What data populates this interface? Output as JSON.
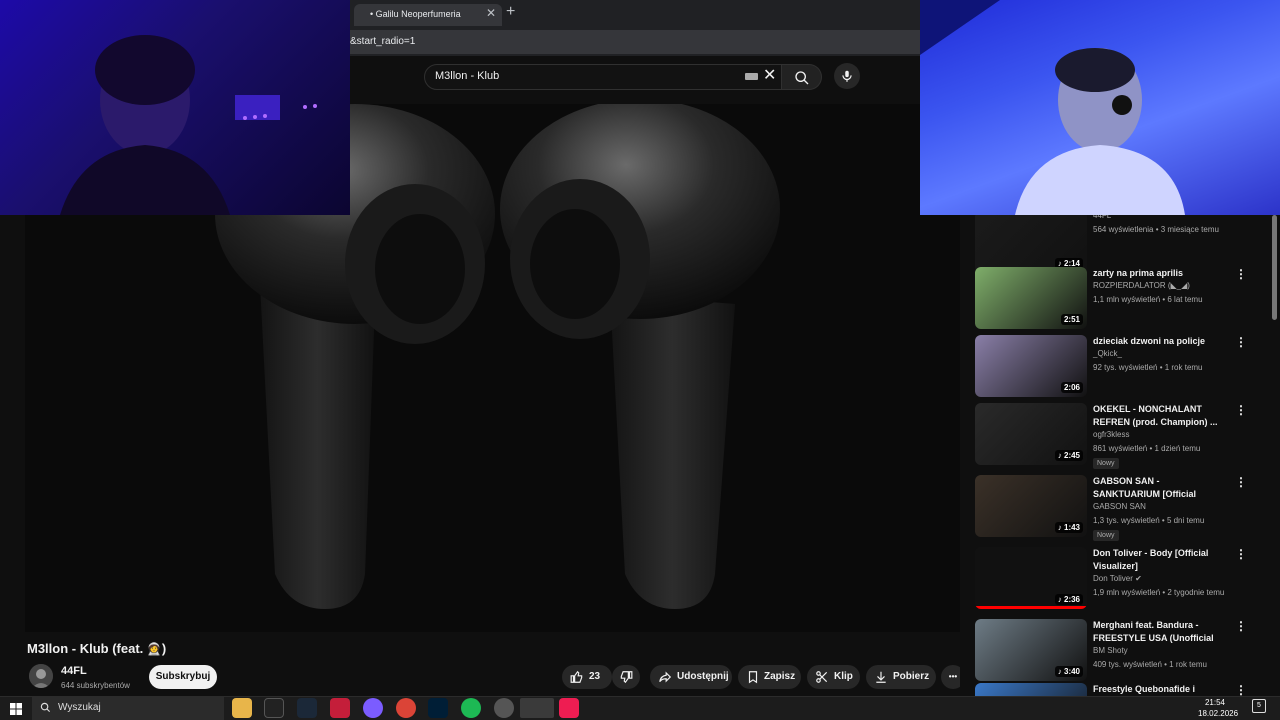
{
  "browser": {
    "tab_title": "• Galilu Neoperfumeria",
    "tab_close": "✕",
    "new_tab": "+",
    "url_fragment": "&start_radio=1"
  },
  "search": {
    "value": "M3llon - Klub"
  },
  "video": {
    "title": "M3llon - Klub (feat. ",
    "title_emoji": "🧑‍🚀",
    "title_close": ")",
    "channel": "44FL",
    "subscribers": "644 subskrybentów",
    "subscribe_label": "Subskrybuj",
    "likes": "23",
    "share_label": "Udostępnij",
    "save_label": "Zapisz",
    "clip_label": "Klip",
    "download_label": "Pobierz",
    "more_label": "•••"
  },
  "sidebar": {
    "items": [
      {
        "title": "",
        "channel": "44FL",
        "meta": "564 wyświetlenia • 3 miesiące temu",
        "duration": "♪ 2:14",
        "badge": "",
        "thumb_color": "#1b1b1b"
      },
      {
        "title": "zarty na prima aprilis",
        "channel": "ROZPIERDALATOR (◣_◢)",
        "meta": "1,1 mln wyświetleń • 6 lat temu",
        "duration": "2:51",
        "badge": "",
        "thumb_color": "#7fae6a"
      },
      {
        "title": "dzieciak dzwoni na policje",
        "channel": "_Qkick_",
        "meta": "92 tys. wyświetleń • 1 rok temu",
        "duration": "2:06",
        "badge": "",
        "thumb_color": "#8a7fa8"
      },
      {
        "title": "OKEKEL - NONCHALANT REFREN (prod. Champion) ...",
        "channel": "ogfr3kless",
        "meta": "861 wyświetleń • 1 dzień temu",
        "duration": "♪ 2:45",
        "badge": "Nowy",
        "thumb_color": "#2a2a2a"
      },
      {
        "title": "GABSON SAN - SANKTUARIUM [Official Music Video]",
        "channel": "GABSON SAN",
        "meta": "1,3 tys. wyświetleń • 5 dni temu",
        "duration": "♪ 1:43",
        "badge": "Nowy",
        "thumb_color": "#3b3128"
      },
      {
        "title": "Don Toliver - Body [Official Visualizer]",
        "channel": "Don Toliver ✔",
        "meta": "1,9 mln wyświetleń • 2 tygodnie temu",
        "duration": "♪ 2:36",
        "badge": "",
        "thumb_color": "#111111"
      },
      {
        "title": "Merghani feat. Bandura - FREESTYLE USA (Unofficial ...",
        "channel": "BM Shoty",
        "meta": "409 tys. wyświetleń • 1 rok temu",
        "duration": "♪ 3:40",
        "badge": "",
        "thumb_color": "#6e7c86"
      },
      {
        "title": "Freestyle Quebonafide i Solara",
        "channel": "",
        "meta": "",
        "duration": "",
        "badge": "",
        "thumb_color": "#3a78c8"
      }
    ]
  },
  "taskbar": {
    "search_placeholder": "Wyszukaj",
    "time": "21:54",
    "date": "18.02.2026",
    "notif_count": "5"
  }
}
